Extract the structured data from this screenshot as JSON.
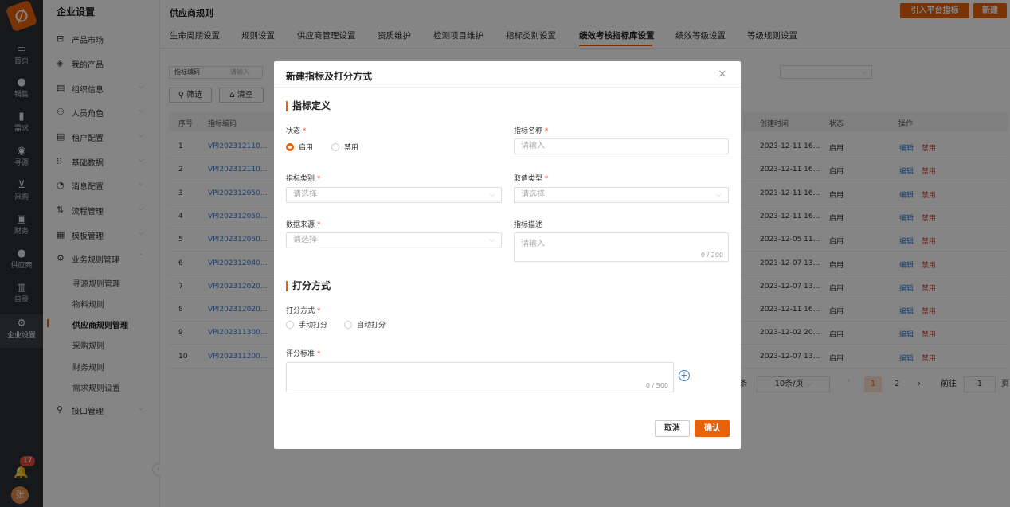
{
  "rail": {
    "items": [
      {
        "label": "首页",
        "icon": "monitor-icon"
      },
      {
        "label": "销售",
        "icon": "person-icon"
      },
      {
        "label": "需求",
        "icon": "clipboard-icon"
      },
      {
        "label": "寻源",
        "icon": "search-icon"
      },
      {
        "label": "采购",
        "icon": "cart-icon"
      },
      {
        "label": "财务",
        "icon": "wallet-icon"
      },
      {
        "label": "供应商",
        "icon": "supplier-icon"
      },
      {
        "label": "目录",
        "icon": "catalog-icon"
      },
      {
        "label": "企业设置",
        "icon": "gear-icon"
      }
    ],
    "notification_count": "17",
    "avatar_text": "张"
  },
  "sidebar": {
    "title": "企业设置",
    "items": [
      {
        "label": "产品市场",
        "icon": "market-icon"
      },
      {
        "label": "我的产品",
        "icon": "product-icon"
      },
      {
        "label": "组织信息",
        "icon": "org-icon"
      },
      {
        "label": "人员角色",
        "icon": "people-icon"
      },
      {
        "label": "租户配置",
        "icon": "tenant-icon"
      },
      {
        "label": "基础数据",
        "icon": "data-icon"
      },
      {
        "label": "消息配置",
        "icon": "message-icon"
      },
      {
        "label": "流程管理",
        "icon": "flow-icon"
      },
      {
        "label": "模板管理",
        "icon": "template-icon"
      },
      {
        "label": "业务规则管理",
        "icon": "rules-icon"
      }
    ],
    "sub_items": [
      "寻源规则管理",
      "物料规则",
      "供应商规则管理",
      "采购规则",
      "财务规则",
      "需求规则设置"
    ],
    "last_item": {
      "label": "接口管理",
      "icon": "api-icon"
    }
  },
  "header": {
    "title": "供应商规则",
    "import_button": "引入平台指标",
    "new_button": "新建"
  },
  "tabs": [
    "生命周期设置",
    "规则设置",
    "供应商管理设置",
    "资质维护",
    "检测项目维护",
    "指标类别设置",
    "绩效考核指标库设置",
    "绩效等级设置",
    "等级规则设置"
  ],
  "filter": {
    "code_label": "指标编码",
    "code_placeholder": "请输入",
    "filter_button": "筛选",
    "clear_button": "清空"
  },
  "table": {
    "headers": {
      "index": "序号",
      "code": "指标编码",
      "created": "创建时间",
      "status": "状态",
      "ops": "操作"
    },
    "edit_label": "编辑",
    "disable_label": "禁用",
    "rows": [
      {
        "index": "1",
        "code": "VPI202312110...",
        "created": "2023-12-11 16...",
        "status": "启用"
      },
      {
        "index": "2",
        "code": "VPI202312110...",
        "created": "2023-12-11 16...",
        "status": "启用"
      },
      {
        "index": "3",
        "code": "VPI202312050...",
        "created": "2023-12-11 16...",
        "status": "启用"
      },
      {
        "index": "4",
        "code": "VPI202312050...",
        "created": "2023-12-11 16...",
        "status": "启用"
      },
      {
        "index": "5",
        "code": "VPI202312050...",
        "created": "2023-12-05 11...",
        "status": "启用"
      },
      {
        "index": "6",
        "code": "VPI202312040...",
        "created": "2023-12-07 13...",
        "status": "启用"
      },
      {
        "index": "7",
        "code": "VPI202312020...",
        "created": "2023-12-07 13...",
        "status": "启用"
      },
      {
        "index": "8",
        "code": "VPI202312020...",
        "created": "2023-12-11 16...",
        "status": "启用"
      },
      {
        "index": "9",
        "code": "VPI202311300...",
        "created": "2023-12-02 20...",
        "status": "启用"
      },
      {
        "index": "10",
        "code": "VPI202311200...",
        "created": "2023-12-07 13...",
        "status": "启用"
      }
    ]
  },
  "pagination": {
    "total_suffix": "条",
    "page_size": "10条/页",
    "pages": [
      "1",
      "2"
    ],
    "goto_label": "前往",
    "goto_value": "1",
    "page_suffix": "页"
  },
  "modal": {
    "title": "新建指标及打分方式",
    "section1": "指标定义",
    "status_label": "状态",
    "status_options": [
      "启用",
      "禁用"
    ],
    "status_selected": "启用",
    "name_label": "指标名称",
    "name_placeholder": "请输入",
    "category_label": "指标类别",
    "category_placeholder": "请选择",
    "value_type_label": "取值类型",
    "value_type_placeholder": "请选择",
    "source_label": "数据来源",
    "source_placeholder": "请选择",
    "desc_label": "指标描述",
    "desc_placeholder": "请输入",
    "desc_count": "0 / 200",
    "section2": "打分方式",
    "scoring_label": "打分方式",
    "scoring_options": [
      "手动打分",
      "自动打分"
    ],
    "criteria_label": "评分标准",
    "criteria_count": "0 / 500",
    "cancel_button": "取消",
    "confirm_button": "确认",
    "required_mark": "*"
  },
  "colors": {
    "accent": "#e8620b",
    "link": "#3a7bd5",
    "danger": "#e5503a",
    "rail": "#2b2f36"
  }
}
